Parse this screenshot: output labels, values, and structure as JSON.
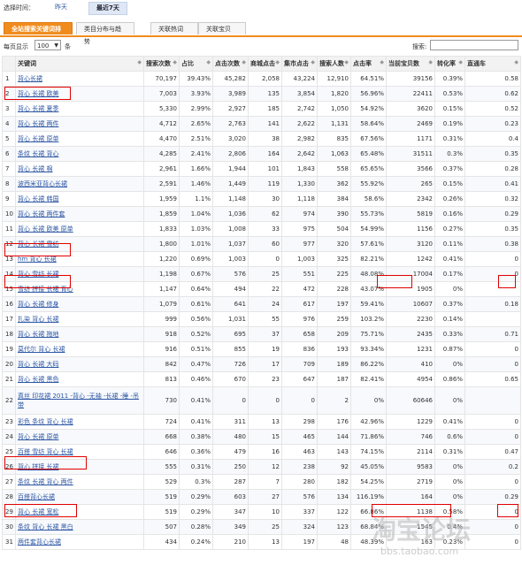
{
  "time_filter": {
    "label": "选择时间：",
    "options": [
      "昨天",
      "最近7天"
    ],
    "selected": "最近7天"
  },
  "tabs": [
    "全站搜索关键词排行",
    "类目分布与趋势",
    "关联热词",
    "关联宝贝"
  ],
  "controls": {
    "page_size_prefix": "每页显示",
    "page_size": "100",
    "page_size_suffix": "条",
    "search_label": "搜索:",
    "search_value": ""
  },
  "table": {
    "columns": [
      "关键词",
      "搜索次数",
      "占比",
      "点击次数",
      "商城点击",
      "集市点击",
      "搜索人数",
      "点击率",
      "当前宝贝数",
      "转化率",
      "直通车"
    ],
    "rows": [
      [
        "1",
        "背心长裙",
        "70,197",
        "39.43%",
        "45,282",
        "2,058",
        "43,224",
        "12,910",
        "64.51%",
        "39156",
        "0.39%",
        "0.58"
      ],
      [
        "2",
        "背心 长裙 欧美",
        "7,003",
        "3.93%",
        "3,989",
        "135",
        "3,854",
        "1,820",
        "56.96%",
        "22411",
        "0.53%",
        "0.62"
      ],
      [
        "3",
        "背心 长裙 夏季",
        "5,330",
        "2.99%",
        "2,927",
        "185",
        "2,742",
        "1,050",
        "54.92%",
        "3620",
        "0.15%",
        "0.52"
      ],
      [
        "4",
        "背心 长裙 两件",
        "4,712",
        "2.65%",
        "2,763",
        "141",
        "2,622",
        "1,131",
        "58.64%",
        "2469",
        "0.19%",
        "0.23"
      ],
      [
        "5",
        "背心 长裙 原单",
        "4,470",
        "2.51%",
        "3,020",
        "38",
        "2,982",
        "835",
        "67.56%",
        "1171",
        "0.31%",
        "0.4"
      ],
      [
        "6",
        "条纹 长裙 背心",
        "4,285",
        "2.41%",
        "2,806",
        "164",
        "2,642",
        "1,063",
        "65.48%",
        "31511",
        "0.3%",
        "0.35"
      ],
      [
        "7",
        "背心 长裙 棉",
        "2,961",
        "1.66%",
        "1,944",
        "101",
        "1,843",
        "558",
        "65.65%",
        "3566",
        "0.37%",
        "0.28"
      ],
      [
        "8",
        "波西米亚背心长裙",
        "2,591",
        "1.46%",
        "1,449",
        "119",
        "1,330",
        "362",
        "55.92%",
        "265",
        "0.15%",
        "0.41"
      ],
      [
        "9",
        "背心 长裙 韩国",
        "1,959",
        "1.1%",
        "1,148",
        "30",
        "1,118",
        "384",
        "58.6%",
        "2342",
        "0.26%",
        "0.32"
      ],
      [
        "10",
        "背心 长裙 两件套",
        "1,859",
        "1.04%",
        "1,036",
        "62",
        "974",
        "390",
        "55.73%",
        "5819",
        "0.16%",
        "0.29"
      ],
      [
        "11",
        "背心 长裙 欧美 原单",
        "1,833",
        "1.03%",
        "1,008",
        "33",
        "975",
        "504",
        "54.99%",
        "1156",
        "0.27%",
        "0.35"
      ],
      [
        "12",
        "背心 长裙 雪纺",
        "1,800",
        "1.01%",
        "1,037",
        "60",
        "977",
        "320",
        "57.61%",
        "3120",
        "0.11%",
        "0.38"
      ],
      [
        "13",
        "hm 背心 长裙",
        "1,220",
        "0.69%",
        "1,003",
        "0",
        "1,003",
        "325",
        "82.21%",
        "1242",
        "0.41%",
        "0"
      ],
      [
        "14",
        "背心 雪纺 长裙",
        "1,198",
        "0.67%",
        "576",
        "25",
        "551",
        "225",
        "48.08%",
        "17004",
        "0.17%",
        "0"
      ],
      [
        "15",
        "雪纺 拼接 长裙 背心",
        "1,147",
        "0.64%",
        "494",
        "22",
        "472",
        "228",
        "43.07%",
        "1905",
        "0%",
        ""
      ],
      [
        "16",
        "背心 长裙 修身",
        "1,079",
        "0.61%",
        "641",
        "24",
        "617",
        "197",
        "59.41%",
        "10607",
        "0.37%",
        "0.18"
      ],
      [
        "17",
        "扎染 背心 长裙",
        "999",
        "0.56%",
        "1,031",
        "55",
        "976",
        "259",
        "103.2%",
        "2230",
        "0.14%",
        ""
      ],
      [
        "18",
        "背心 长裙 拖地",
        "918",
        "0.52%",
        "695",
        "37",
        "658",
        "209",
        "75.71%",
        "2435",
        "0.33%",
        "0.71"
      ],
      [
        "19",
        "莫代尔 背心 长裙",
        "916",
        "0.51%",
        "855",
        "19",
        "836",
        "193",
        "93.34%",
        "1231",
        "0.87%",
        "0"
      ],
      [
        "20",
        "背心 长裙 大码",
        "842",
        "0.47%",
        "726",
        "17",
        "709",
        "189",
        "86.22%",
        "410",
        "0%",
        "0"
      ],
      [
        "21",
        "背心 长裙 黑色",
        "813",
        "0.46%",
        "670",
        "23",
        "647",
        "187",
        "82.41%",
        "4954",
        "0.86%",
        "0.65"
      ],
      [
        "22",
        "真丝 印花裙 2011 -背心 -无袖 -长裙 -睡 -吊带",
        "730",
        "0.41%",
        "0",
        "0",
        "0",
        "2",
        "0%",
        "60646",
        "0%",
        ""
      ],
      [
        "23",
        "彩色 条纹 背心 长裙",
        "724",
        "0.41%",
        "311",
        "13",
        "298",
        "176",
        "42.96%",
        "1229",
        "0.41%",
        "0"
      ],
      [
        "24",
        "背心 长裙 原单",
        "668",
        "0.38%",
        "480",
        "15",
        "465",
        "144",
        "71.86%",
        "746",
        "0.6%",
        "0"
      ],
      [
        "25",
        "百搭 雪纺 背心 长裙",
        "646",
        "0.36%",
        "479",
        "16",
        "463",
        "143",
        "74.15%",
        "2114",
        "0.31%",
        "0.47"
      ],
      [
        "26",
        "背心 拼接 长裙",
        "555",
        "0.31%",
        "250",
        "12",
        "238",
        "92",
        "45.05%",
        "9583",
        "0%",
        "0.2"
      ],
      [
        "27",
        "条纹 长裙 背心 两件",
        "529",
        "0.3%",
        "287",
        "7",
        "280",
        "182",
        "54.25%",
        "2719",
        "0%",
        "0"
      ],
      [
        "28",
        "百搭背心长裙",
        "519",
        "0.29%",
        "603",
        "27",
        "576",
        "134",
        "116.19%",
        "164",
        "0%",
        "0.29"
      ],
      [
        "29",
        "背心 长裙 宽松",
        "519",
        "0.29%",
        "347",
        "10",
        "337",
        "122",
        "66.86%",
        "1138",
        "0.58%",
        "0"
      ],
      [
        "30",
        "条纹 背心 长裙 黑白",
        "507",
        "0.28%",
        "349",
        "25",
        "324",
        "123",
        "68.84%",
        "1545",
        "0.4%",
        "0"
      ],
      [
        "31",
        "两件套背心长裙",
        "434",
        "0.24%",
        "210",
        "13",
        "197",
        "48",
        "48.39%",
        "163",
        "0.23%",
        "0"
      ]
    ]
  },
  "watermark": {
    "brand": "淘宝论坛",
    "url": "bbs.taobao.com"
  },
  "colors": {
    "accent": "#f08c1e",
    "link": "#2b55a3",
    "highlight": "#e00000"
  }
}
